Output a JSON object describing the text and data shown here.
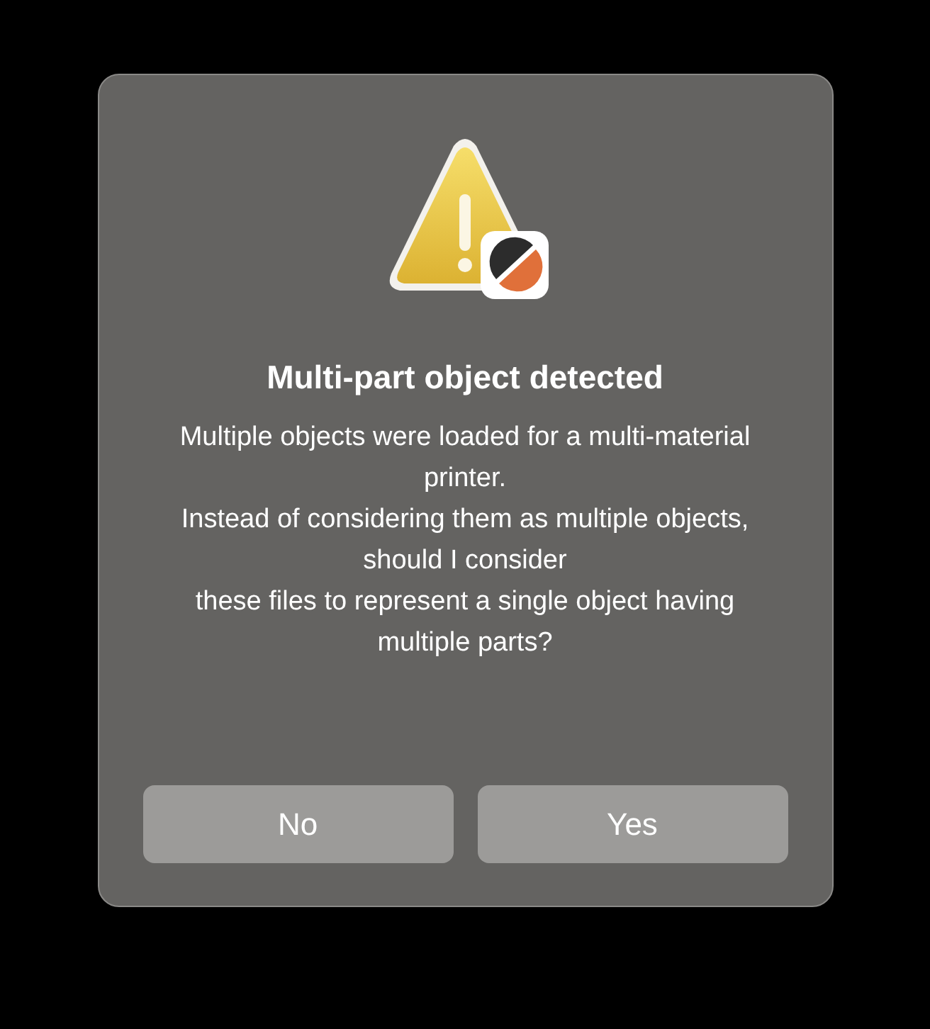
{
  "dialog": {
    "title": "Multi-part object detected",
    "message": "Multiple objects were loaded for a multi-material printer.\nInstead of considering them as multiple objects, should I consider\nthese files to represent a single object having multiple parts?",
    "buttons": [
      {
        "label": "No"
      },
      {
        "label": "Yes"
      }
    ]
  }
}
